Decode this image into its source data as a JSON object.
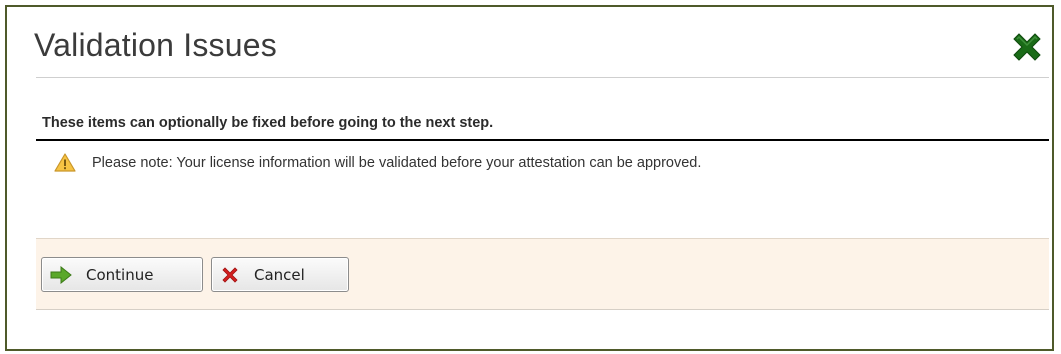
{
  "dialog": {
    "title": "Validation Issues",
    "close_icon": "close-x-icon"
  },
  "section": {
    "heading": "These items can optionally be fixed before going to the next step."
  },
  "note": {
    "icon": "warning-icon",
    "text": "Please note: Your license information will be validated before your attestation can be approved."
  },
  "footer": {
    "continue_label": "Continue",
    "continue_icon": "arrow-right-icon",
    "cancel_label": "Cancel",
    "cancel_icon": "red-x-icon"
  },
  "colors": {
    "close_icon": "#1a6b17",
    "continue_arrow": "#5aa82a",
    "cancel_x": "#d42020",
    "warning_fill": "#f6c343",
    "footer_bg": "#fdf3e8",
    "dialog_border": "#4f5a2a"
  }
}
